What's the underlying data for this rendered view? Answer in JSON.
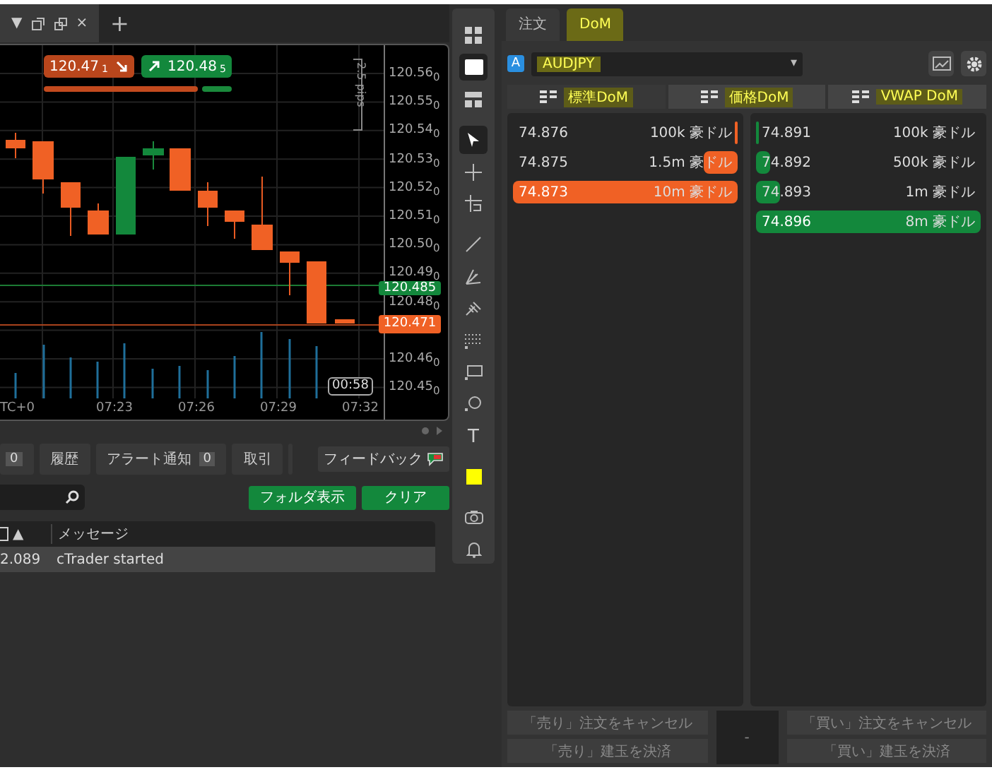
{
  "chart_tabs": {
    "caret": "▼",
    "close": "×",
    "add": "+"
  },
  "chart": {
    "bid": {
      "price": "120.47",
      "pip": "1"
    },
    "ask": {
      "price": "120.48",
      "pip": "5"
    },
    "spread": "2.5 pips",
    "price_labels": [
      "120.56$_{0}$",
      "120.55$_{0}$",
      "120.54$_{0}$",
      "120.53$_{0}$",
      "120.52$_{0}$",
      "120.51$_{0}$",
      "120.50$_{0}$",
      "120.49$_{0}$",
      "120.48$_{0}$",
      "120.46$_{0}$",
      "120.45$_{0}$"
    ],
    "ask_tag": "120.485",
    "bid_tag": "120.471",
    "time_labels": [
      "TC+0",
      "07:23",
      "07:26",
      "07:29",
      "07:32"
    ],
    "countdown": "00:58"
  },
  "bottom_tabs": [
    {
      "badge": "0"
    },
    {
      "label": "履歴"
    },
    {
      "label": "アラート通知",
      "badge": "0"
    },
    {
      "label": "取引"
    }
  ],
  "feedback": "フィードバック",
  "log_buttons": [
    "フォルダ表示",
    "クリア"
  ],
  "log_table": {
    "columns": [
      "▲",
      "メッセージ"
    ],
    "rows": [
      [
        "2.089",
        "cTrader started"
      ]
    ]
  },
  "toolbar": [
    {
      "kind": "grid",
      "selected": false
    },
    {
      "kind": "window",
      "selected": true
    },
    {
      "kind": "layout",
      "selected": false
    },
    {
      "kind": "pointer",
      "selected": true
    },
    {
      "kind": "cross",
      "selected": false
    },
    {
      "kind": "plus",
      "selected": false
    },
    {
      "kind": "line",
      "selected": false
    },
    {
      "kind": "fan",
      "selected": false
    },
    {
      "kind": "fork",
      "selected": false
    },
    {
      "kind": "dots",
      "selected": false
    },
    {
      "kind": "rect",
      "selected": false
    },
    {
      "kind": "circle",
      "selected": false
    },
    {
      "kind": "text",
      "selected": false,
      "label": "T"
    },
    {
      "kind": "color",
      "selected": false,
      "color": "#ffff00"
    },
    {
      "kind": "camera",
      "selected": false
    },
    {
      "kind": "bell",
      "selected": false
    }
  ],
  "panel_tabs": [
    {
      "label": "注文",
      "selected": false
    },
    {
      "label": "DoM",
      "selected": true
    }
  ],
  "symbol": {
    "badge": "A",
    "value": "AUDJPY",
    "caret": "▾"
  },
  "dom_types": [
    {
      "label": "標準DoM",
      "selected": true
    },
    {
      "label": "価格DoM",
      "selected": false
    },
    {
      "label": "VWAP DoM",
      "selected": false
    }
  ],
  "sell": [
    {
      "price": "74.876",
      "volume": "100k 豪ドル",
      "level": 0.01,
      "best": false
    },
    {
      "price": "74.875",
      "volume": "1.5m 豪ドル",
      "level": 0.15,
      "best": false
    },
    {
      "price": "74.873",
      "volume": "10m 豪ドル",
      "level": 1,
      "best": true
    }
  ],
  "buy": [
    {
      "price": "74.891",
      "volume": "100k 豪ドル",
      "level": 0.01,
      "best": false
    },
    {
      "price": "74.892",
      "volume": "500k 豪ドル",
      "level": 0.06,
      "best": false
    },
    {
      "price": "74.893",
      "volume": "1m 豪ドル",
      "level": 0.11,
      "best": false
    },
    {
      "price": "74.896",
      "volume": "8m 豪ドル",
      "level": 1,
      "best": true
    }
  ],
  "actions": {
    "sell": [
      "「売り」注文をキャンセル",
      "「売り」建玉を決済"
    ],
    "center": "-",
    "buy": [
      "「買い」注文をキャンセル",
      "「買い」建玉を決済"
    ]
  }
}
